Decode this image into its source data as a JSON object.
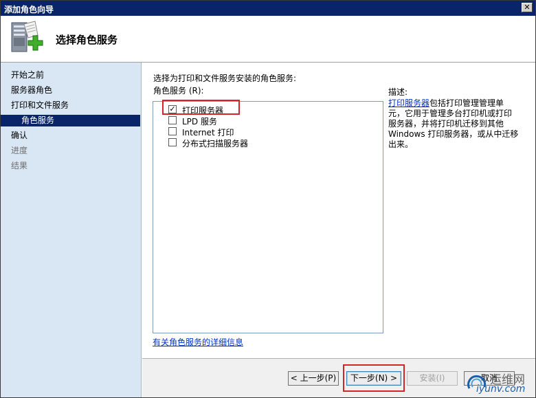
{
  "window": {
    "title": "添加角色向导",
    "close_label": "✕"
  },
  "header": {
    "title": "选择角色服务",
    "icon": "server-add-icon"
  },
  "nav": {
    "items": [
      {
        "label": "开始之前",
        "state": "normal"
      },
      {
        "label": "服务器角色",
        "state": "normal"
      },
      {
        "label": "打印和文件服务",
        "state": "normal"
      },
      {
        "label": "角色服务",
        "state": "selected"
      },
      {
        "label": "确认",
        "state": "normal"
      },
      {
        "label": "进度",
        "state": "disabled"
      },
      {
        "label": "结果",
        "state": "disabled"
      }
    ]
  },
  "main": {
    "instruction": "选择为打印和文件服务安装的角色服务:",
    "list_label": "角色服务 (R):",
    "roles": [
      {
        "label": "打印服务器",
        "checked": true
      },
      {
        "label": "LPD 服务",
        "checked": false
      },
      {
        "label": "Internet 打印",
        "checked": false
      },
      {
        "label": "分布式扫描服务器",
        "checked": false
      }
    ],
    "description_label": "描述:",
    "description_link": "打印服务器",
    "description_text": "包括打印管理管理单元，它用于管理多台打印机或打印服务器，并将打印机迁移到其他 Windows 打印服务器，或从中迁移出来。",
    "details_link": "有关角色服务的详细信息"
  },
  "footer": {
    "prev_label": "< 上一步(P)",
    "next_label": "下一步(N) >",
    "install_label": "安装(I)",
    "cancel_label": "取消"
  },
  "watermark": {
    "line1": "运维网",
    "line2": "iyunv.com"
  },
  "colors": {
    "titlebar": "#0a246a",
    "nav_bg": "#d9e6f4",
    "highlight": "#d0262b",
    "link": "#0033cc"
  }
}
